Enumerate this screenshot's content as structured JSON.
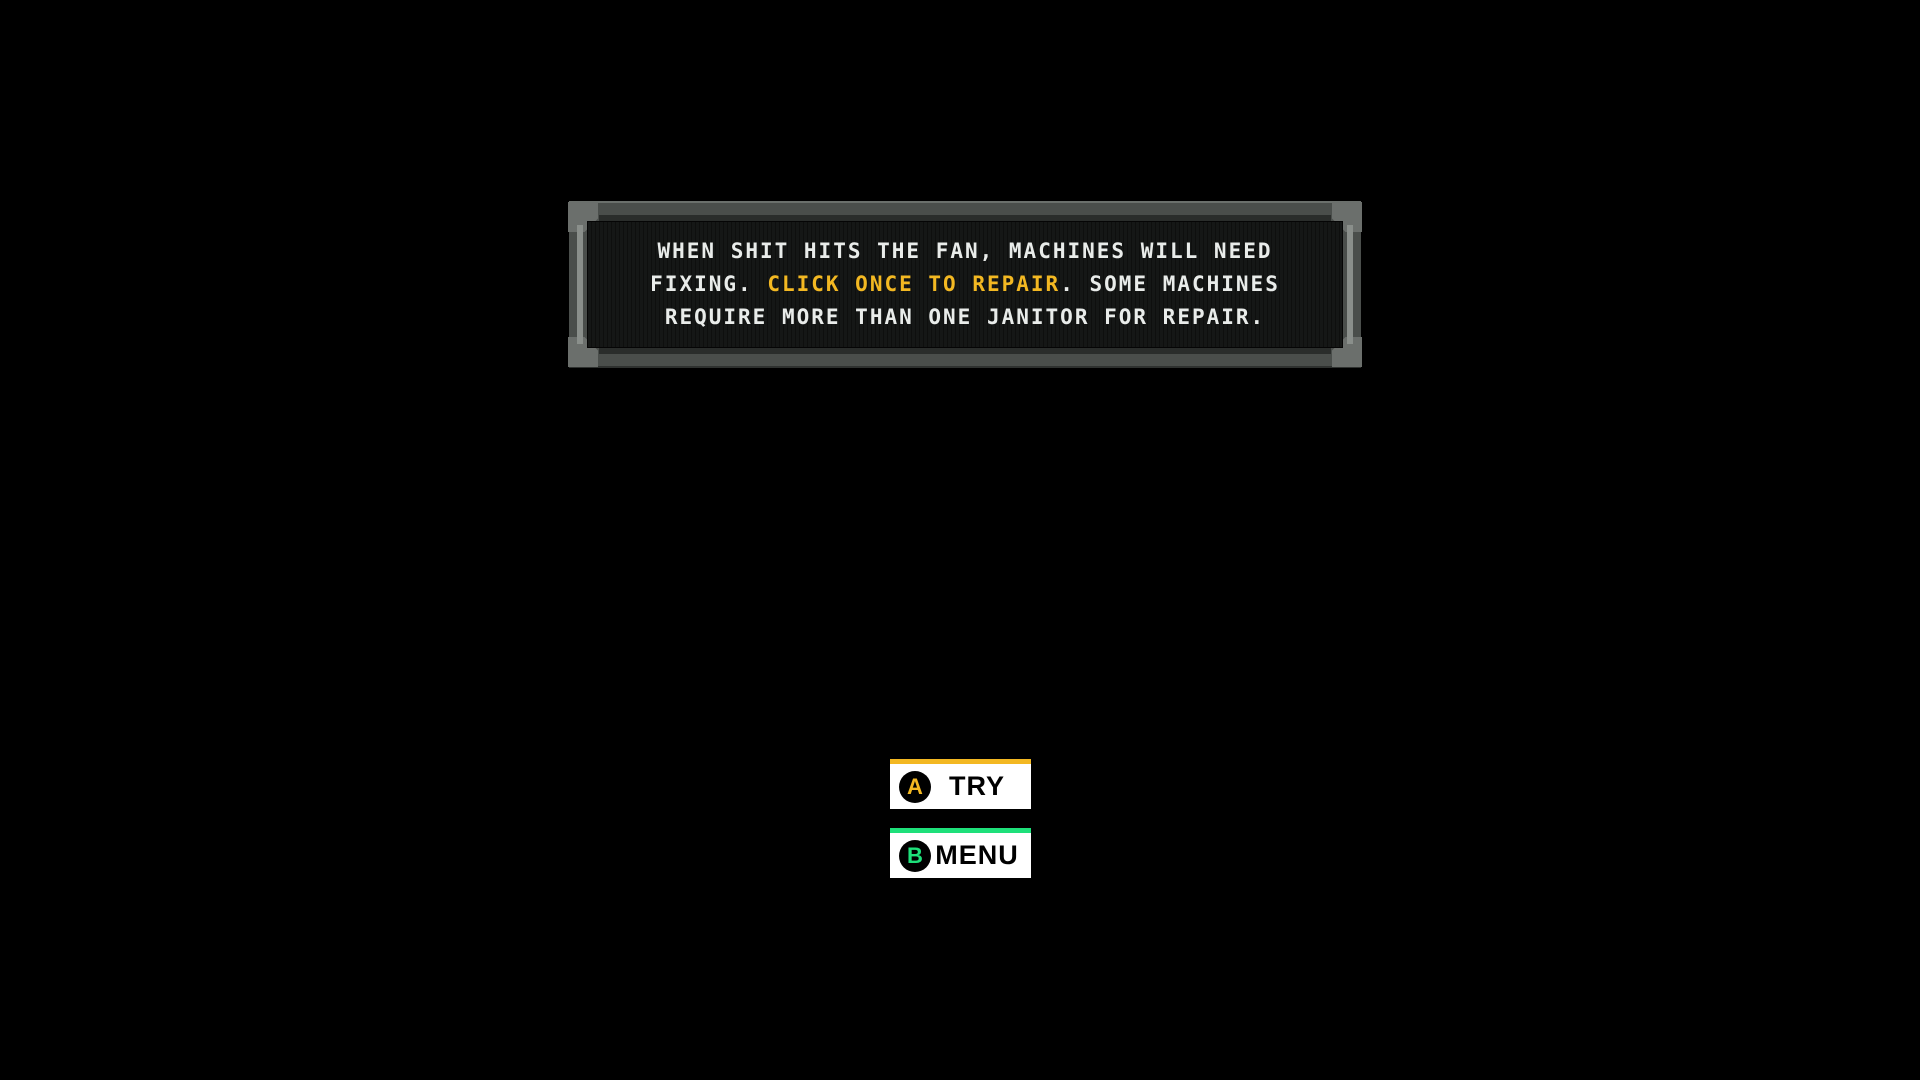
{
  "tutorial": {
    "text_before": "When shit hits the fan, machines will need fixing. ",
    "text_highlight": "Click once to repair",
    "text_after": ". Some machines require more than one janitor for repair."
  },
  "buttons": [
    {
      "key": "A",
      "label": "TRY",
      "key_color": "#f3b822"
    },
    {
      "key": "B",
      "label": "MENU",
      "key_color": "#1ee07a"
    }
  ],
  "colors": {
    "background": "#000000",
    "highlight": "#f3b822",
    "panel_frame": "#4a4e4b",
    "button_bg": "#ffffff"
  }
}
